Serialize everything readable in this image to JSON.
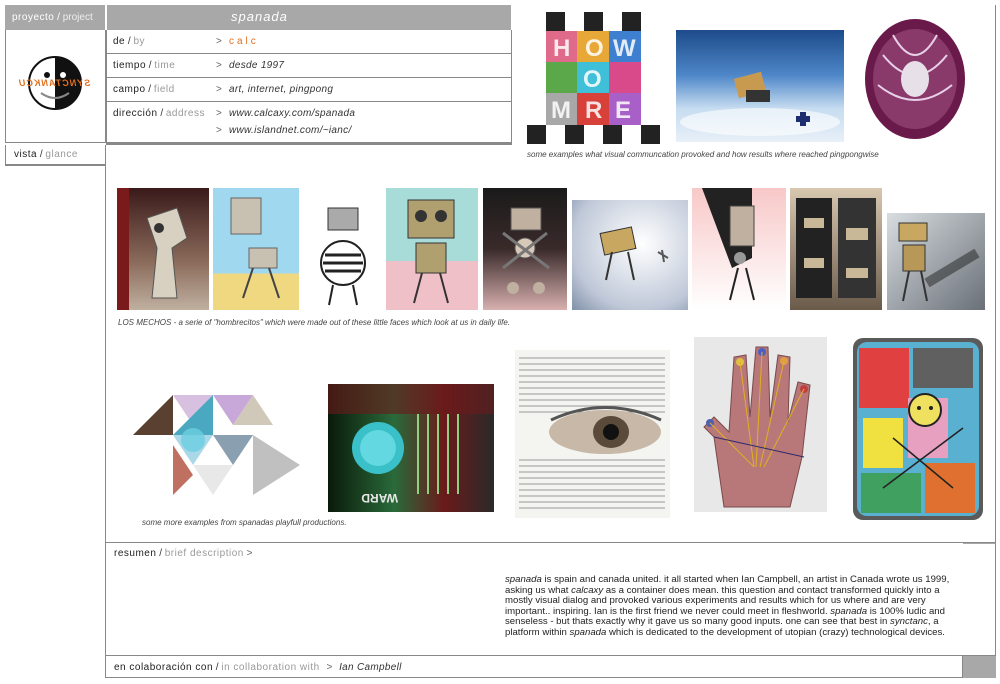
{
  "header": {
    "project_label": "proyecto",
    "project_sub": "project",
    "title": "spanada",
    "separator": "/"
  },
  "logo": {
    "text": "SYNCTANKCU"
  },
  "info_rows": [
    {
      "label": "de",
      "sub": "by",
      "value": "calc"
    },
    {
      "label": "tiempo",
      "sub": "time",
      "value": "desde 1997"
    },
    {
      "label": "campo",
      "sub": "field",
      "value": "art, internet, pingpong"
    },
    {
      "label": "dirección",
      "sub": "address",
      "value": "www.calcaxy.com/spanada"
    },
    {
      "label": "",
      "sub": "",
      "value": "www.islandnet.com/~ianc/"
    }
  ],
  "arrow": ">",
  "glance": {
    "label": "vista",
    "sub": "glance"
  },
  "captions": {
    "top": "some examples what visual communcation provoked and how results where reached pingpongwise",
    "mechos": "LOS MECHOS - a serie of \"hombrecitos\" which were made out of these little faces which look at us in daily life.",
    "more": "some more examples from spanadas playfull productions."
  },
  "summary": {
    "label": "resumen",
    "sub": "brief description",
    "arrow": ">",
    "p1_a": "spanada",
    "p1_b": " is spain and canada united. it all started when Ian Campbell, an artist in Canada wrote us 1999, asking us what ",
    "p1_c": "calcaxy",
    "p1_d": " as a container does mean. this question and contact transformed quickly into a mostly visual dialog and provoked various experiments and results which for us where and are very important.. inspiring. Ian is the first friend we never could meet in fleshworld. ",
    "p1_e": "spanada",
    "p1_f": " is 100% ludic and senseless - but thats exactly why it gave us so many good inputs. one can see that best in ",
    "p1_g": "synctanc",
    "p1_h": ", a platform within ",
    "p1_i": "spanada",
    "p1_j": " which is dedicated to the development of utopian (crazy) technological devices."
  },
  "collab": {
    "label": "en colaboración con",
    "sub": "in collaboration with",
    "arrow": ">",
    "value": "Ian Campbell"
  },
  "grid_letters": [
    "H",
    "O",
    "W",
    "M",
    "O",
    "R",
    "E"
  ],
  "colors": {
    "accent": "#e07020",
    "bar": "#a8a8a8",
    "border": "#888888"
  }
}
